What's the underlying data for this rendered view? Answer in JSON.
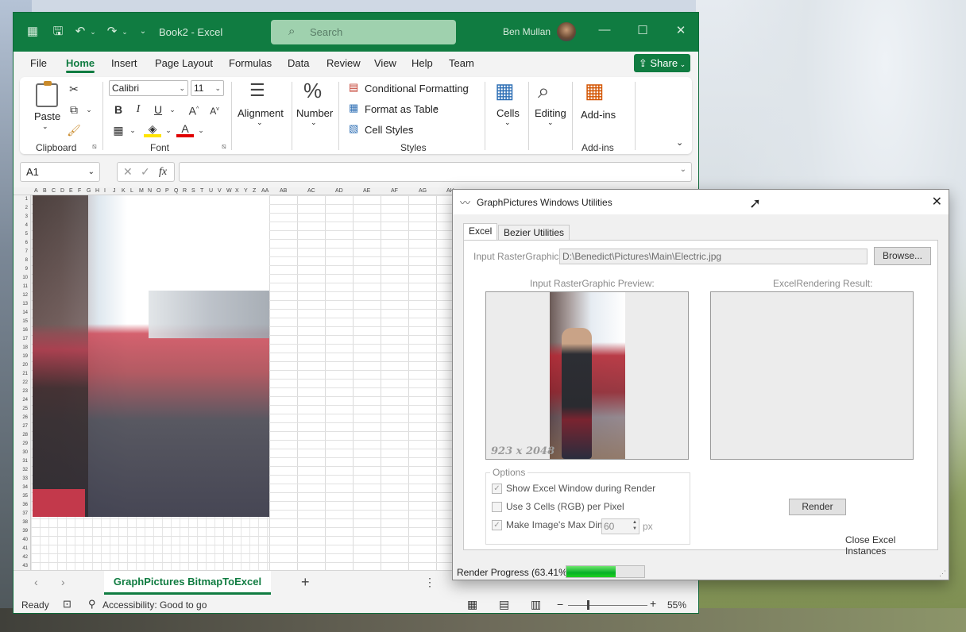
{
  "excel": {
    "title": "Book2 - Excel",
    "search_placeholder": "Search",
    "user_name": "Ben Mullan",
    "menu": [
      "File",
      "Home",
      "Insert",
      "Page Layout",
      "Formulas",
      "Data",
      "Review",
      "View",
      "Help",
      "Team"
    ],
    "share_label": "Share",
    "ribbon": {
      "paste": "Paste",
      "clipboard": "Clipboard",
      "font_name": "Calibri",
      "font_size": "11",
      "font_group": "Font",
      "alignment": "Alignment",
      "number": "Number",
      "conditional_formatting": "Conditional Formatting",
      "format_as_table": "Format as Table",
      "cell_styles": "Cell Styles",
      "styles_group": "Styles",
      "cells": "Cells",
      "editing": "Editing",
      "addins": "Add-ins",
      "addins_group": "Add-ins"
    },
    "name_box": "A1",
    "columns": [
      "A",
      "B",
      "C",
      "D",
      "E",
      "F",
      "G",
      "H",
      "I",
      "J",
      "K",
      "L",
      "M",
      "N",
      "O",
      "P",
      "Q",
      "R",
      "S",
      "T",
      "U",
      "V",
      "W",
      "X",
      "Y",
      "Z",
      "AA"
    ],
    "wide_columns": [
      "AB",
      "AC",
      "AD",
      "AE",
      "AF",
      "AG",
      "AH"
    ],
    "rows_count": 43,
    "sheet_tab": "GraphPictures BitmapToExcel",
    "status": {
      "ready": "Ready",
      "accessibility": "Accessibility: Good to go",
      "zoom": "55%"
    }
  },
  "dialog": {
    "title": "GraphPictures Windows Utilities",
    "tabs": [
      "Excel",
      "Bezier Utilities"
    ],
    "input_label": "Input RasterGraphic:",
    "input_path": "D:\\Benedict\\Pictures\\Main\\Electric.jpg",
    "browse": "Browse...",
    "preview_label": "Input RasterGraphic Preview:",
    "result_label": "ExcelRendering Result:",
    "dimensions": "923 x 2048",
    "options_legend": "Options",
    "opt_show_window": "Show Excel Window during Render",
    "opt_3cells": "Use 3 Cells (RGB) per Pixel",
    "opt_max_dim": "Make Image's Max Dimension:",
    "max_dim_value": "60",
    "px": "px",
    "render": "Render",
    "close_instances": "Close Excel Instances",
    "progress_label": "Render Progress (63.41%)",
    "progress": 0.6341
  }
}
